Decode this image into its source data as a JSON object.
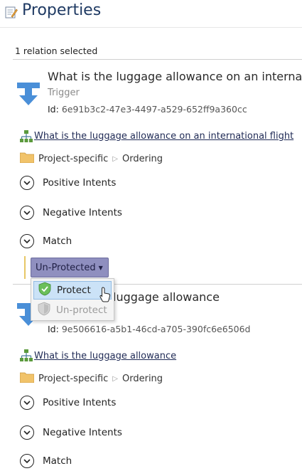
{
  "panel": {
    "title": "Properties",
    "selection_count": "1 relation selected"
  },
  "items": [
    {
      "title": "What is the luggage allowance on an internati",
      "type": "Trigger",
      "id_label": "Id:",
      "id_value": "6e91b3c2-47e3-4497-a529-652ff9a360cc",
      "link": "What is the luggage allowance on an international flight",
      "breadcrumb": [
        "Project-specific",
        "Ordering"
      ],
      "sections": [
        "Positive Intents",
        "Negative Intents",
        "Match"
      ]
    },
    {
      "title": "luggage allowance",
      "id_label": "Id:",
      "id_value": "9e506616-a5b1-46cd-a705-390fc6e6506d",
      "link": "What is the luggage allowance",
      "breadcrumb": [
        "Project-specific",
        "Ordering"
      ],
      "sections": [
        "Positive Intents",
        "Negative Intents",
        "Match"
      ]
    }
  ],
  "protection": {
    "button_label": "Un-Protected",
    "menu": [
      {
        "label": "Protect",
        "state": "highlighted"
      },
      {
        "label": "Un-protect",
        "state": "disabled"
      }
    ]
  },
  "colors": {
    "title": "#1f3a63",
    "trigger_icon": "#4a8fd8",
    "button": "#8f8fbf",
    "menu_highlight": "#cbe2f7",
    "separator_accent": "#e7c766"
  },
  "icons": [
    "properties-icon",
    "trigger-arrow-icon",
    "hierarchy-icon",
    "folder-icon",
    "chevron-right-icon",
    "chevron-down-icon",
    "dropdown-caret-icon",
    "shield-check-icon",
    "shield-icon",
    "mouse-cursor-icon"
  ]
}
